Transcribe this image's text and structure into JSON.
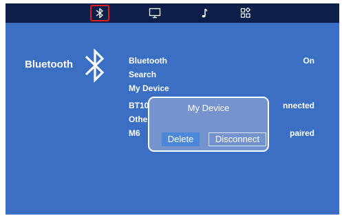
{
  "topbar": {
    "tabs": [
      {
        "icon": "bluetooth-icon",
        "selected": true
      },
      {
        "icon": "monitor-icon",
        "selected": false
      },
      {
        "icon": "music-note-icon",
        "selected": false
      },
      {
        "icon": "apps-grid-icon",
        "selected": false
      }
    ]
  },
  "section": {
    "title": "Bluetooth",
    "icon": "bluetooth-icon"
  },
  "settings": {
    "rows": [
      {
        "label": "Bluetooth",
        "value": "On"
      },
      {
        "label": "Search",
        "value": ""
      },
      {
        "label": "My Device",
        "value": ""
      },
      {
        "label": "BT10",
        "value": "nnected"
      },
      {
        "label": "Othe",
        "value": ""
      },
      {
        "label": "M6",
        "value": "paired"
      }
    ]
  },
  "dialog": {
    "title": "My Device",
    "delete_label": "Delete",
    "disconnect_label": "Disconnect"
  },
  "colors": {
    "screen_bg": "#3a6fc4",
    "topbar_bg": "#0b1f4a",
    "selection_border": "#e02020"
  }
}
